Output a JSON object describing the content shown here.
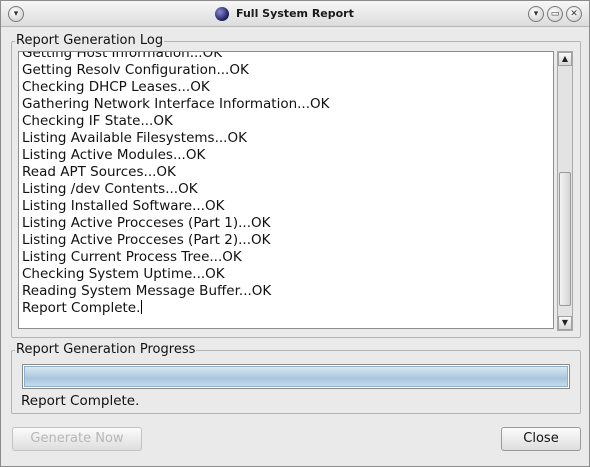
{
  "window": {
    "title": "Full System Report",
    "controls": {
      "menu": "▾",
      "minimize": "▾",
      "maximize": "▭",
      "close": "✕"
    }
  },
  "log_group": {
    "title": "Report Generation Log",
    "lines": [
      "Getting Host Information...OK",
      "Getting Resolv Configuration...OK",
      "Checking DHCP Leases...OK",
      "Gathering Network Interface Information...OK",
      "Checking IF State...OK",
      "Listing Available Filesystems...OK",
      "Listing Active Modules...OK",
      "Read APT Sources...OK",
      "Listing /dev Contents...OK",
      "Listing Installed Software...OK",
      "Listing Active Procceses (Part 1)...OK",
      "Listing Active Procceses (Part 2)...OK",
      "Listing Current Process Tree...OK",
      "Checking System Uptime...OK",
      "Reading System Message Buffer...OK",
      "Report Complete."
    ]
  },
  "progress_group": {
    "title": "Report Generation Progress",
    "progress": 1.0,
    "status": "Report Complete."
  },
  "buttons": {
    "generate_label": "Generate Now",
    "close_label": "Close"
  },
  "icons": {
    "app": "app-globe-icon",
    "scroll_up": "arrow-up-icon",
    "scroll_down": "arrow-down-icon"
  }
}
